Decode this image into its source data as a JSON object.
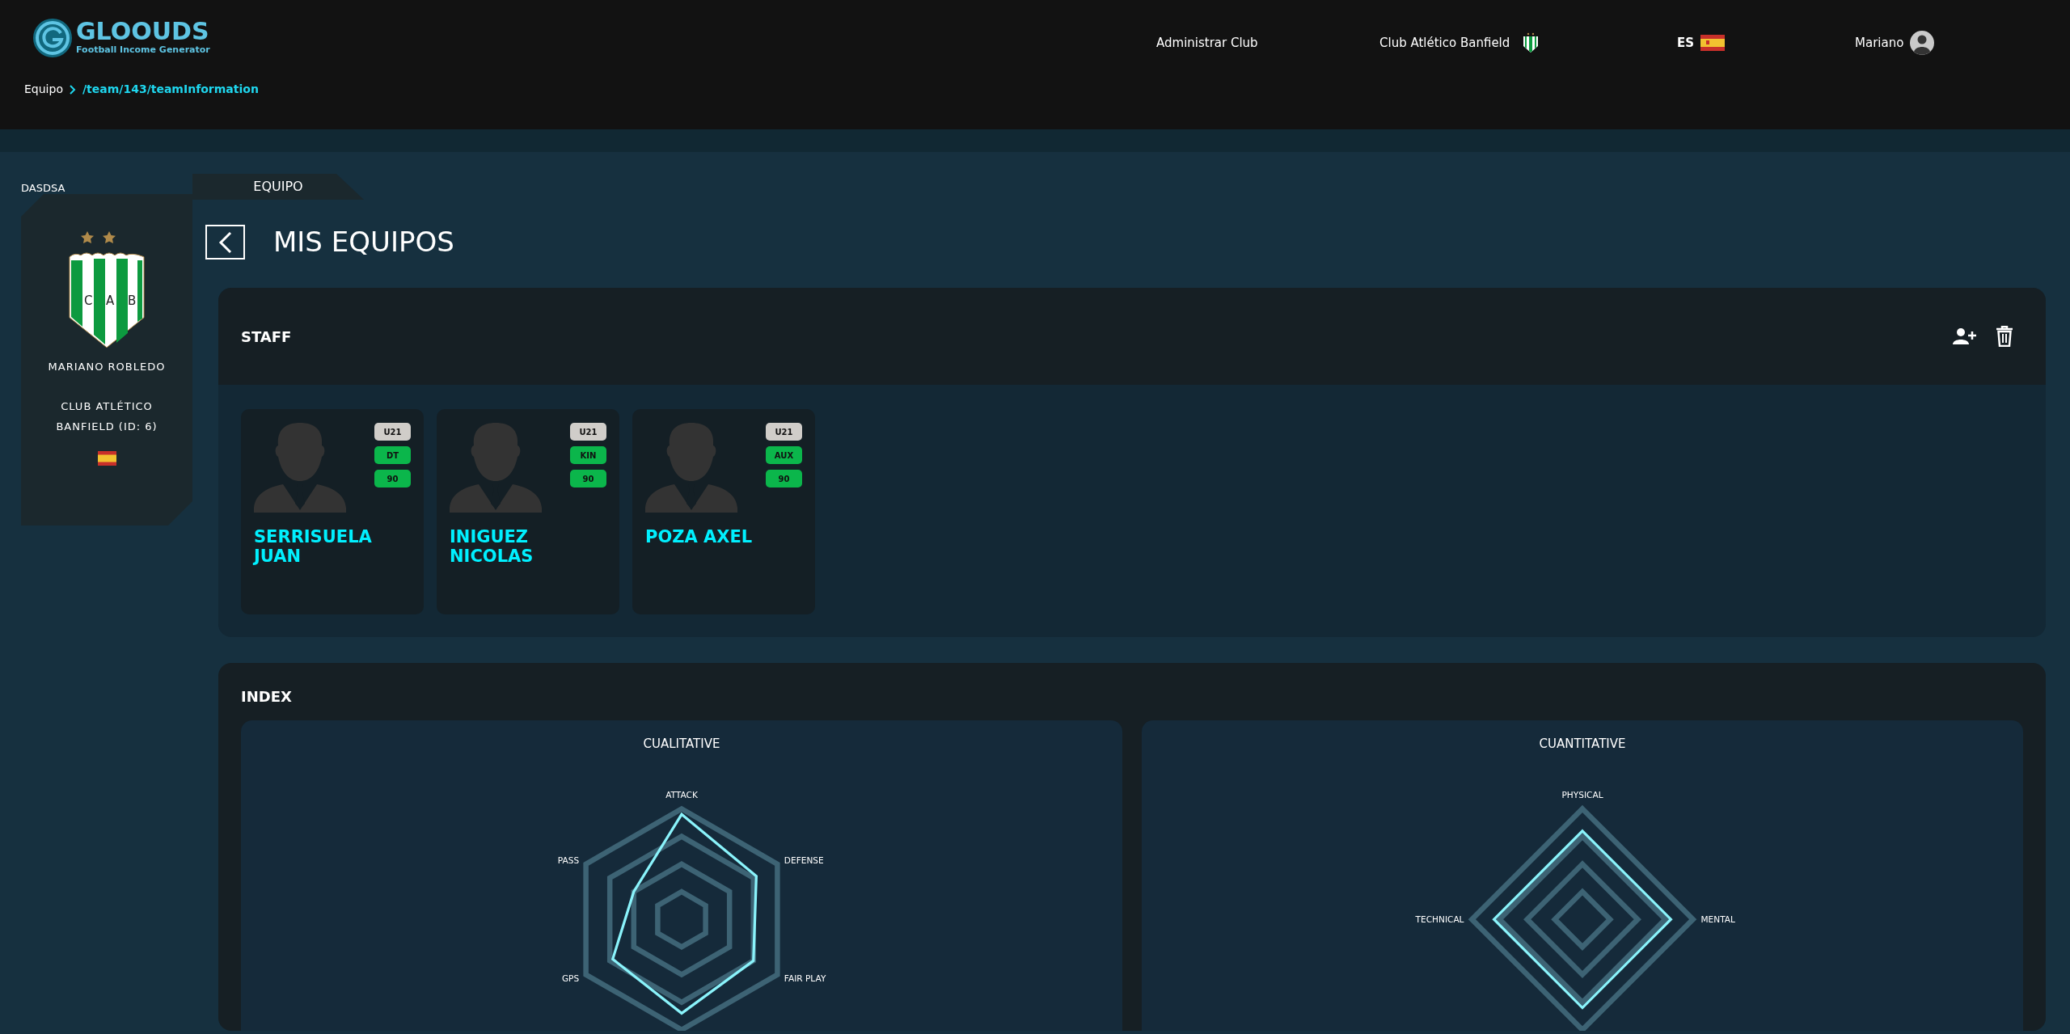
{
  "header": {
    "brand": "GLOOUDS",
    "tagline": "Football Income Generator",
    "admin_link": "Administrar Club",
    "club": "Club Atlético Banfield",
    "language": "ES",
    "user": "Mariano"
  },
  "breadcrumb": {
    "root": "Equipo",
    "path": "/team/143/teamInformation"
  },
  "sidebar": {
    "title": "DASDSA",
    "manager": "MARIANO ROBLEDO",
    "club": "CLUB ATLÉTICO BANFIELD (ID: 6)",
    "crest_letters": [
      "C",
      "A",
      "B"
    ]
  },
  "tab": "EQUIPO",
  "page_title": "MIS EQUIPOS",
  "staff": {
    "title": "STAFF",
    "members": [
      {
        "name": "SERRISUELA JUAN",
        "badges": [
          {
            "text": "U21",
            "color": "#d0cdc9"
          },
          {
            "text": "DT",
            "color": "#0bb64b"
          },
          {
            "text": "90",
            "color": "#0bb64b"
          }
        ]
      },
      {
        "name": "INIGUEZ NICOLAS",
        "badges": [
          {
            "text": "U21",
            "color": "#d0cdc9"
          },
          {
            "text": "KIN",
            "color": "#0bb64b"
          },
          {
            "text": "90",
            "color": "#0bb64b"
          }
        ]
      },
      {
        "name": "POZA AXEL",
        "badges": [
          {
            "text": "U21",
            "color": "#d0cdc9"
          },
          {
            "text": "AUX",
            "color": "#0bb64b"
          },
          {
            "text": "90",
            "color": "#0bb64b"
          }
        ]
      }
    ]
  },
  "index": {
    "title": "INDEX",
    "charts": [
      {
        "title": "CUALITATIVE",
        "kind": "hexagon",
        "axes": [
          "ATTACK",
          "DEFENSE",
          "FAIR PLAY",
          "GPS",
          "PASS"
        ]
      },
      {
        "title": "CUANTITATIVE",
        "kind": "diamond",
        "axes": [
          "PHYSICAL",
          "MENTAL",
          "TECHNICAL"
        ]
      }
    ]
  }
}
